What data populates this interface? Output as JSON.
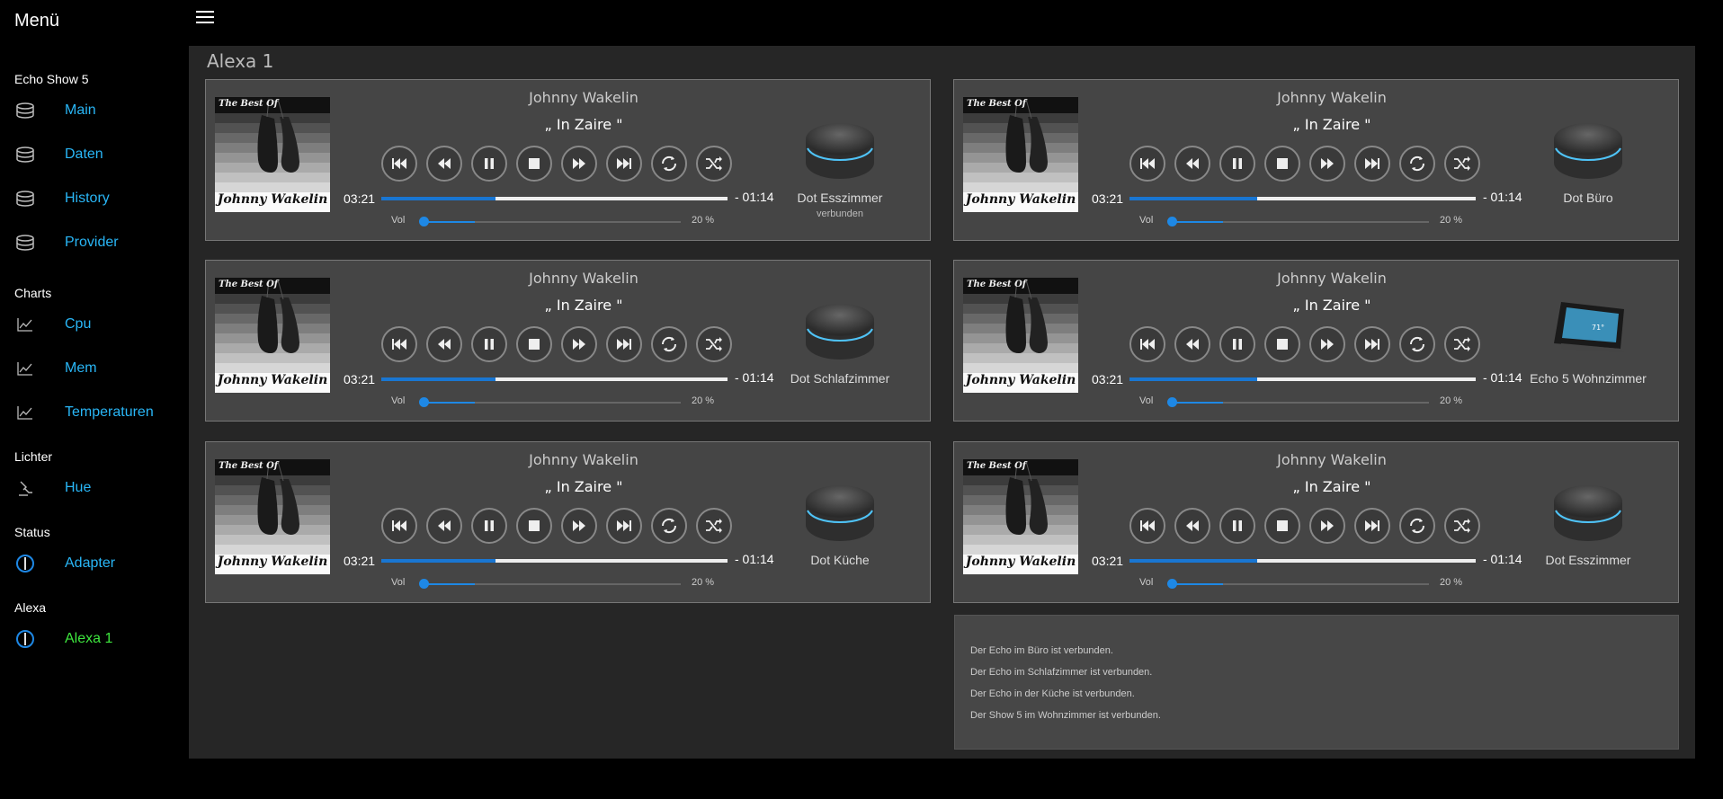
{
  "sidebar": {
    "title": "Menü",
    "sections": [
      {
        "label": "Echo Show 5",
        "items": [
          {
            "label": "Main",
            "icon": "database-icon"
          },
          {
            "label": "Daten",
            "icon": "database-icon"
          },
          {
            "label": "History",
            "icon": "database-icon"
          },
          {
            "label": "Provider",
            "icon": "database-icon"
          }
        ]
      },
      {
        "label": "Charts",
        "items": [
          {
            "label": "Cpu",
            "icon": "line-chart-icon"
          },
          {
            "label": "Mem",
            "icon": "line-chart-icon"
          },
          {
            "label": "Temperaturen",
            "icon": "line-chart-icon"
          }
        ]
      },
      {
        "label": "Lichter",
        "items": [
          {
            "label": "Hue",
            "icon": "lamp-icon"
          }
        ]
      },
      {
        "label": "Status",
        "items": [
          {
            "label": "Adapter",
            "icon": "power-icon"
          }
        ]
      },
      {
        "label": "Alexa",
        "items": [
          {
            "label": "Alexa 1",
            "icon": "power-icon",
            "active": true
          }
        ]
      }
    ]
  },
  "page": {
    "title": "Alexa 1"
  },
  "players": [
    {
      "artist": "Johnny Wakelin",
      "song": "„ In Zaire \"",
      "time_elapsed": "03:21",
      "time_remaining": "- 01:14",
      "progress": 0.33,
      "volume_label": "Vol",
      "volume": 20,
      "volume_text": "20 %",
      "device": "Dot Esszimmer",
      "status": "verbunden",
      "device_type": "echo-dot",
      "cover_text_top": "The Best Of",
      "cover_text_bottom": "Johnny Wakelin"
    },
    {
      "artist": "Johnny Wakelin",
      "song": "„ In Zaire \"",
      "time_elapsed": "03:21",
      "time_remaining": "- 01:14",
      "progress": 0.37,
      "volume_label": "Vol",
      "volume": 20,
      "volume_text": "20 %",
      "device": "Dot Büro",
      "status": "",
      "device_type": "echo-dot",
      "cover_text_top": "The Best Of",
      "cover_text_bottom": "Johnny Wakelin"
    },
    {
      "artist": "Johnny Wakelin",
      "song": "„ In Zaire \"",
      "time_elapsed": "03:21",
      "time_remaining": "- 01:14",
      "progress": 0.33,
      "volume_label": "Vol",
      "volume": 20,
      "volume_text": "20 %",
      "device": "Dot Schlafzimmer",
      "status": "",
      "device_type": "echo-dot",
      "cover_text_top": "The Best Of",
      "cover_text_bottom": "Johnny Wakelin"
    },
    {
      "artist": "Johnny Wakelin",
      "song": "„ In Zaire \"",
      "time_elapsed": "03:21",
      "time_remaining": "- 01:14",
      "progress": 0.37,
      "volume_label": "Vol",
      "volume": 20,
      "volume_text": "20 %",
      "device": "Echo 5 Wohnzimmer",
      "status": "",
      "device_type": "echo-show",
      "cover_text_top": "The Best Of",
      "cover_text_bottom": "Johnny Wakelin"
    },
    {
      "artist": "Johnny Wakelin",
      "song": "„ In Zaire \"",
      "time_elapsed": "03:21",
      "time_remaining": "- 01:14",
      "progress": 0.33,
      "volume_label": "Vol",
      "volume": 20,
      "volume_text": "20 %",
      "device": "Dot Küche",
      "status": "",
      "device_type": "echo-dot",
      "cover_text_top": "The Best Of",
      "cover_text_bottom": "Johnny Wakelin"
    },
    {
      "artist": "Johnny Wakelin",
      "song": "„ In Zaire \"",
      "time_elapsed": "03:21",
      "time_remaining": "- 01:14",
      "progress": 0.37,
      "volume_label": "Vol",
      "volume": 20,
      "volume_text": "20 %",
      "device": "Dot Esszimmer",
      "status": "",
      "device_type": "echo-dot",
      "cover_text_top": "The Best Of",
      "cover_text_bottom": "Johnny Wakelin"
    }
  ],
  "controls": [
    "skip-previous-icon",
    "rewind-icon",
    "pause-icon",
    "stop-icon",
    "fast-forward-icon",
    "skip-next-icon",
    "repeat-icon",
    "shuffle-icon"
  ],
  "log": [
    "Der Echo im Büro ist verbunden.",
    "Der Echo im Schlafzimmer ist verbunden.",
    "Der Echo in der Küche ist verbunden.",
    "Der Show 5 im Wohnzimmer ist verbunden."
  ],
  "colors": {
    "accent": "#1976d2",
    "link": "#29b6f6",
    "active": "#3ee63e",
    "panel": "#454545",
    "background": "#262626"
  }
}
